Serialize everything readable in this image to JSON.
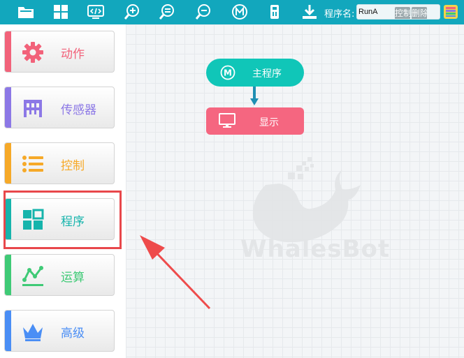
{
  "toolbar": {
    "icons": [
      "open-folder-icon",
      "program-grid-icon",
      "code-monitor-icon",
      "zoom-in-icon",
      "zoom-reset-icon",
      "zoom-out-icon",
      "main-program-icon",
      "robot-icon",
      "download-icon",
      "palette-icon"
    ],
    "program_name_label": "程序名:",
    "program_name_value": "RunA",
    "control_button_1": "控制",
    "control_button_2": "删除",
    "background_color": "#12a7bd"
  },
  "sidebar": {
    "categories": [
      {
        "label": "动作",
        "color": "#f2627a",
        "icon": "gear-icon"
      },
      {
        "label": "传感器",
        "color": "#8c78e6",
        "icon": "sensor-icon"
      },
      {
        "label": "控制",
        "color": "#f6a928",
        "icon": "list-icon"
      },
      {
        "label": "程序",
        "color": "#16b4ac",
        "icon": "program-grid-icon"
      },
      {
        "label": "运算",
        "color": "#3fca76",
        "icon": "chart-line-icon"
      },
      {
        "label": "高级",
        "color": "#4a8ef5",
        "icon": "crown-icon"
      }
    ],
    "highlighted": "程序"
  },
  "workspace": {
    "main_block_label": "主程序",
    "main_block_icon_letter": "M",
    "display_block_label": "显示",
    "watermark_text": "WhalesBot",
    "main_block_color": "#10c6b8",
    "display_block_color": "#f56680"
  },
  "annotation": {
    "highlight_color": "#e8474b"
  }
}
